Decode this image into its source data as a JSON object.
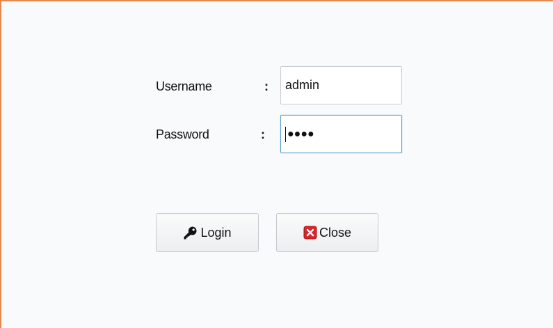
{
  "login_form": {
    "username_label": "Username",
    "username_separator": ":",
    "username_value": "admin",
    "password_label": "Password",
    "password_separator": ":",
    "password_mask": "●●●●"
  },
  "buttons": {
    "login_label": "Login",
    "login_icon": "key-icon",
    "close_label": "Close",
    "close_icon": "close-x-icon"
  },
  "colors": {
    "window_border": "#e8894f",
    "focus_border": "#5ea4cf",
    "close_icon_red": "#d9262b"
  }
}
